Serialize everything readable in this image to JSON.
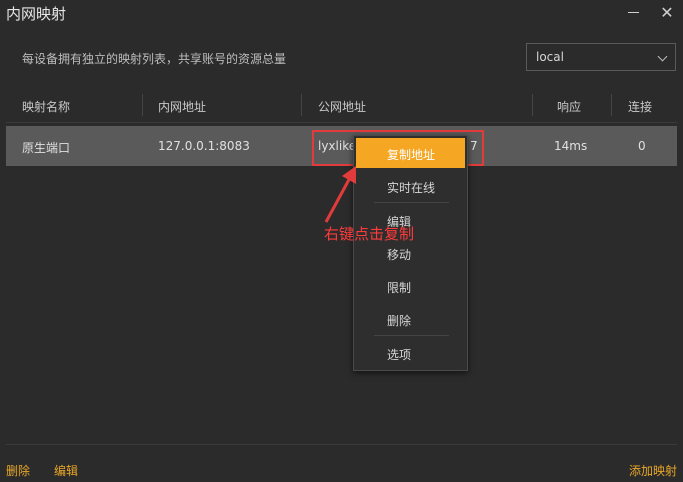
{
  "window": {
    "title": "内网映射",
    "close": "✕"
  },
  "subtitle": "每设备拥有独立的映射列表，共享账号的资源总量",
  "device_select": {
    "value": "local"
  },
  "table": {
    "headers": [
      "映射名称",
      "内网地址",
      "公网地址",
      "响应",
      "连接"
    ],
    "rows": [
      {
        "name": "原生端口",
        "internal": "127.0.0.1:8083",
        "public_prefix": "lyxlike",
        "public_suffix": "7",
        "latency": "14ms",
        "connections": "0"
      }
    ]
  },
  "context_menu": {
    "items": [
      "复制地址",
      "实时在线",
      "编辑",
      "移动",
      "限制",
      "删除",
      "选项"
    ],
    "active_index": 0
  },
  "annotation": "右键点击复制",
  "footer": {
    "delete": "删除",
    "edit": "编辑",
    "add": "添加映射"
  },
  "colors": {
    "accent": "#f5a623",
    "annotation": "#e23b3b",
    "link": "#e8a628"
  }
}
